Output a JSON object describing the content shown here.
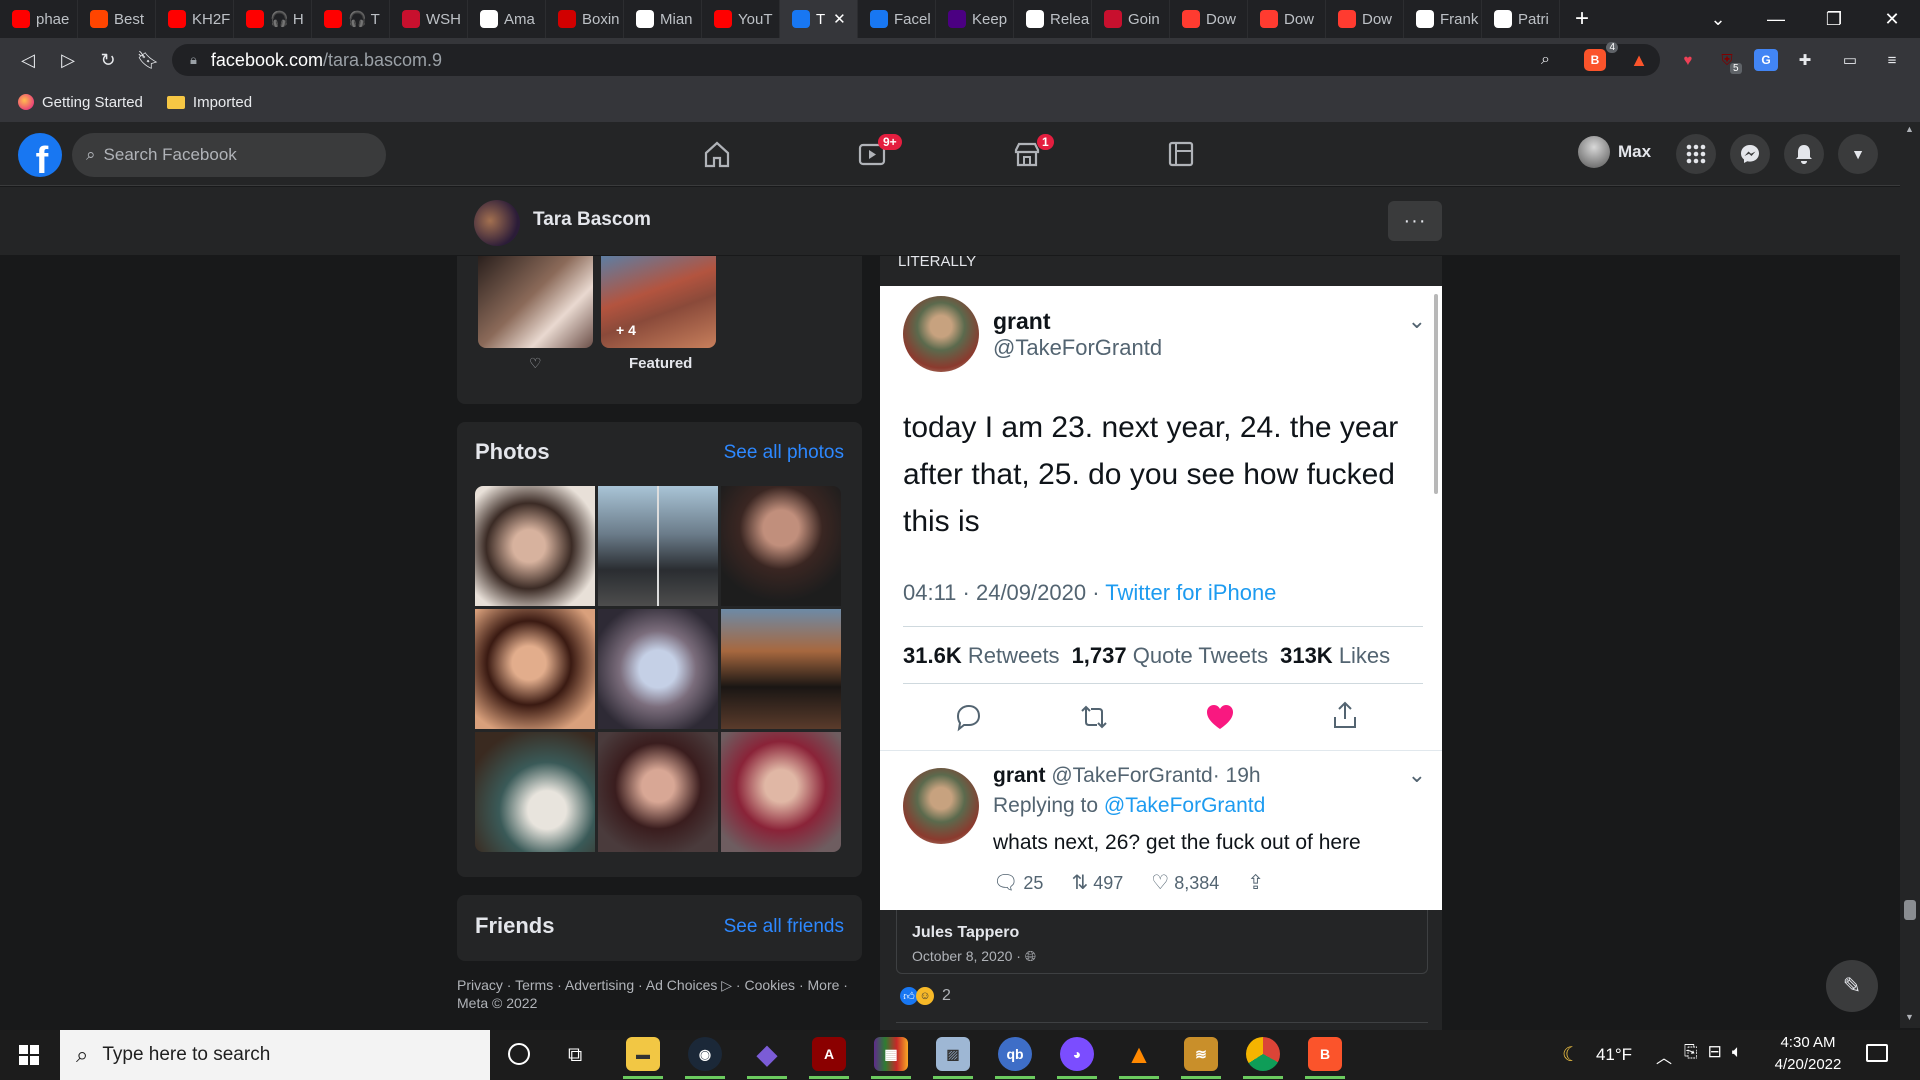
{
  "browser": {
    "tabs": [
      {
        "label": "phae",
        "icon": "youtube-icon",
        "color": "#ff0000"
      },
      {
        "label": "Best",
        "icon": "reddit-icon",
        "color": "#ff4500"
      },
      {
        "label": "KH2F",
        "icon": "youtube-icon",
        "color": "#ff0000"
      },
      {
        "label": "🎧 H",
        "icon": "youtube-icon",
        "color": "#ff0000"
      },
      {
        "label": "🎧 T",
        "icon": "youtube-icon",
        "color": "#ff0000"
      },
      {
        "label": "WSH",
        "icon": "wsh-icon",
        "color": "#c8102e"
      },
      {
        "label": "Ama",
        "icon": "amazon-icon",
        "color": "#ffffff"
      },
      {
        "label": "Boxin",
        "icon": "boxing-icon",
        "color": "#d10000"
      },
      {
        "label": "Mian",
        "icon": "soccer-icon",
        "color": "#ffffff"
      },
      {
        "label": "YouT",
        "icon": "youtube-icon",
        "color": "#ff0000"
      },
      {
        "label": "T",
        "icon": "facebook-icon",
        "color": "#1877f2",
        "active": true
      },
      {
        "label": "Facel",
        "icon": "facebook-icon",
        "color": "#1877f2"
      },
      {
        "label": "Keep",
        "icon": "keep-icon",
        "color": "#4b0082"
      },
      {
        "label": "Relea",
        "icon": "github-icon",
        "color": "#ffffff"
      },
      {
        "label": "Goin",
        "icon": "shield-icon",
        "color": "#c8102e"
      },
      {
        "label": "Dow",
        "icon": "x-icon",
        "color": "#ff3b30"
      },
      {
        "label": "Dow",
        "icon": "x-icon",
        "color": "#ff3b30"
      },
      {
        "label": "Dow",
        "icon": "x-icon",
        "color": "#ff3b30"
      },
      {
        "label": "Frank",
        "icon": "wikipedia-icon",
        "color": "#ffffff"
      },
      {
        "label": "Patri",
        "icon": "wikipedia-icon",
        "color": "#ffffff"
      }
    ],
    "url_host": "facebook.com",
    "url_path": "/tara.bascom.9",
    "bookmarks": [
      "Getting Started",
      "Imported"
    ],
    "brave_badge": "4",
    "ext_badge": "5"
  },
  "fb": {
    "search_placeholder": "Search Facebook",
    "watch_badge": "9+",
    "marketplace_badge": "1",
    "user_name": "Max",
    "profile_name": "Tara Bascom",
    "featured_label": "Featured",
    "featured_more": "+ 4",
    "photos_title": "Photos",
    "see_all_photos": "See all photos",
    "friends_title": "Friends",
    "see_all_friends": "See all friends",
    "footer_line1": "Privacy · Terms · Advertising · Ad Choices ▷ · Cookies · More ·",
    "footer_line2": "Meta © 2022",
    "post_caption": "LITERALLY",
    "comment_author": "Jules Tappero",
    "comment_date": "October 8, 2020 ·",
    "reaction_count": "2"
  },
  "tweet": {
    "name": "grant",
    "handle": "@TakeForGrantd",
    "text": "today I am 23. next year, 24. the year after that, 25. do you see how fucked this is",
    "timestamp": "04:11 · 24/09/2020 · ",
    "source": "Twitter for iPhone",
    "retweets_num": "31.6K",
    "retweets_label": "Retweets",
    "quotes_num": "1,737",
    "quotes_label": "Quote Tweets",
    "likes_num": "313K",
    "likes_label": "Likes",
    "reply_name": "grant",
    "reply_handle": "@TakeForGrantd",
    "reply_time": "· 19h",
    "replying_to_label": "Replying to",
    "replying_to_handle": "@TakeForGrantd",
    "reply_text": "whats next, 26? get the fuck out of here",
    "reply_comments": "25",
    "reply_retweets": "497",
    "reply_likes": "8,384",
    "like_color": "#f91880"
  },
  "taskbar": {
    "search_placeholder": "Type here to search",
    "weather": "41°F",
    "time": "4:30 AM",
    "date": "4/20/2022"
  }
}
